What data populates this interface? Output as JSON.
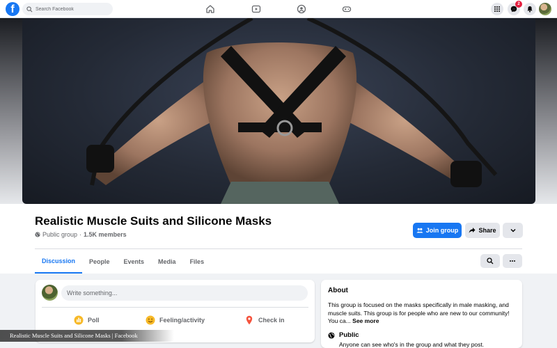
{
  "topbar": {
    "logo_letter": "f",
    "search_placeholder": "Search Facebook",
    "nav_icons": [
      "home-icon",
      "video-icon",
      "groups-icon",
      "gaming-icon"
    ],
    "right_icons": [
      "menu-grid-icon",
      "messenger-icon",
      "notifications-icon"
    ],
    "messenger_badge": "2"
  },
  "group": {
    "title": "Realistic Muscle Suits and Silicone Masks",
    "privacy": "Public group",
    "separator": "·",
    "members": "1.5K members",
    "join_label": "Join group",
    "share_label": "Share"
  },
  "tabs": [
    {
      "label": "Discussion",
      "active": true
    },
    {
      "label": "People",
      "active": false
    },
    {
      "label": "Events",
      "active": false
    },
    {
      "label": "Media",
      "active": false
    },
    {
      "label": "Files",
      "active": false
    }
  ],
  "composer": {
    "placeholder": "Write something...",
    "actions": [
      {
        "label": "Poll",
        "icon": "poll-icon",
        "color": "#f7b928"
      },
      {
        "label": "Feeling/activity",
        "icon": "feeling-icon",
        "color": "#f7b928"
      },
      {
        "label": "Check in",
        "icon": "check-in-icon",
        "color": "#f5533d"
      }
    ]
  },
  "about": {
    "title": "About",
    "description": "This group is focused on the masks specifically in male masking, and muscle suits. This group is for people who are new to our community! You ca...",
    "see_more": "See more",
    "privacy_title": "Public",
    "privacy_desc": "Anyone can see who's in the group and what they post."
  },
  "caption": "Realistic Muscle Suits and Silicone Masks | Facebook",
  "colors": {
    "accent": "#1877f2",
    "badge": "#e41e3f",
    "background": "#f0f2f5"
  }
}
